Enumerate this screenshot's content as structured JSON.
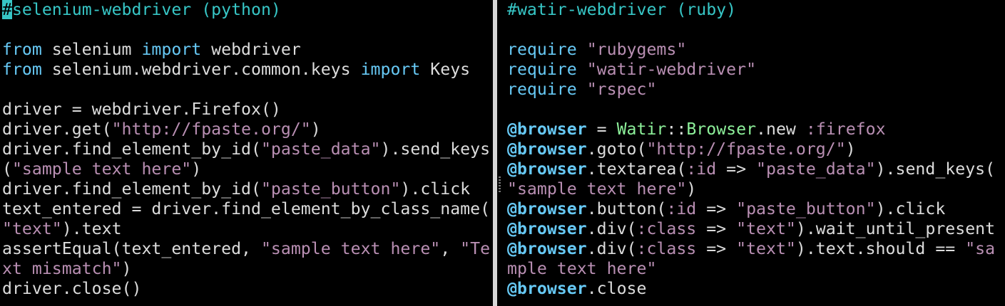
{
  "colors": {
    "background": "#000000",
    "default": "#dcdcdc",
    "keyword": "#67c9f5",
    "string": "#b98fb3",
    "comment": "#37c6c6",
    "ivar": "#67c9f5",
    "const": "#8df09a",
    "symbol": "#b98fb3",
    "cursor": "#37c6c6",
    "divider": "#d8d8d8"
  },
  "left_pane": {
    "lines": [
      [
        {
          "t": "#",
          "c": "cursor"
        },
        {
          "t": "selenium-webdriver (python)",
          "c": "comment"
        }
      ],
      [],
      [
        {
          "t": "from",
          "c": "keyword"
        },
        {
          "t": " selenium ",
          "c": "default"
        },
        {
          "t": "import",
          "c": "keyword"
        },
        {
          "t": " webdriver",
          "c": "default"
        }
      ],
      [
        {
          "t": "from",
          "c": "keyword"
        },
        {
          "t": " selenium.webdriver.common.keys ",
          "c": "default"
        },
        {
          "t": "import",
          "c": "keyword"
        },
        {
          "t": " Keys",
          "c": "default"
        }
      ],
      [],
      [
        {
          "t": "driver = webdriver.Firefox()",
          "c": "default"
        }
      ],
      [
        {
          "t": "driver.get(",
          "c": "default"
        },
        {
          "t": "\"http://fpaste.org/\"",
          "c": "string"
        },
        {
          "t": ")",
          "c": "default"
        }
      ],
      [
        {
          "t": "driver.find_element_by_id(",
          "c": "default"
        },
        {
          "t": "\"paste_data\"",
          "c": "string"
        },
        {
          "t": ").send_keys",
          "c": "default"
        }
      ],
      [
        {
          "t": "(",
          "c": "default"
        },
        {
          "t": "\"sample text here\"",
          "c": "string"
        },
        {
          "t": ")",
          "c": "default"
        }
      ],
      [
        {
          "t": "driver.find_element_by_id(",
          "c": "default"
        },
        {
          "t": "\"paste_button\"",
          "c": "string"
        },
        {
          "t": ").click",
          "c": "default"
        }
      ],
      [
        {
          "t": "text_entered = driver.find_element_by_class_name(",
          "c": "default"
        }
      ],
      [
        {
          "t": "\"text\"",
          "c": "string"
        },
        {
          "t": ").text",
          "c": "default"
        }
      ],
      [
        {
          "t": "assertEqual(text_entered, ",
          "c": "default"
        },
        {
          "t": "\"sample text here\"",
          "c": "string"
        },
        {
          "t": ", ",
          "c": "default"
        },
        {
          "t": "\"Te",
          "c": "string"
        }
      ],
      [
        {
          "t": "xt mismatch\"",
          "c": "string"
        },
        {
          "t": ")",
          "c": "default"
        }
      ],
      [
        {
          "t": "driver.close()",
          "c": "default"
        }
      ]
    ]
  },
  "right_pane": {
    "lines": [
      [
        {
          "t": "#watir-webdriver (ruby)",
          "c": "comment"
        }
      ],
      [],
      [
        {
          "t": "require",
          "c": "keyword"
        },
        {
          "t": " ",
          "c": "default"
        },
        {
          "t": "\"rubygems\"",
          "c": "string"
        }
      ],
      [
        {
          "t": "require",
          "c": "keyword"
        },
        {
          "t": " ",
          "c": "default"
        },
        {
          "t": "\"watir-webdriver\"",
          "c": "string"
        }
      ],
      [
        {
          "t": "require",
          "c": "keyword"
        },
        {
          "t": " ",
          "c": "default"
        },
        {
          "t": "\"rspec\"",
          "c": "string"
        }
      ],
      [],
      [
        {
          "t": "@browser",
          "c": "ivar"
        },
        {
          "t": " = ",
          "c": "default"
        },
        {
          "t": "Watir",
          "c": "const"
        },
        {
          "t": "::",
          "c": "default"
        },
        {
          "t": "Browser",
          "c": "const"
        },
        {
          "t": ".new ",
          "c": "default"
        },
        {
          "t": ":firefox",
          "c": "symbol"
        }
      ],
      [
        {
          "t": "@browser",
          "c": "ivar"
        },
        {
          "t": ".goto(",
          "c": "default"
        },
        {
          "t": "\"http://fpaste.org/\"",
          "c": "string"
        },
        {
          "t": ")",
          "c": "default"
        }
      ],
      [
        {
          "t": "@browser",
          "c": "ivar"
        },
        {
          "t": ".textarea(",
          "c": "default"
        },
        {
          "t": ":id",
          "c": "symbol"
        },
        {
          "t": " => ",
          "c": "default"
        },
        {
          "t": "\"paste_data\"",
          "c": "string"
        },
        {
          "t": ").send_keys(",
          "c": "default"
        }
      ],
      [
        {
          "t": "\"sample text here\"",
          "c": "string"
        },
        {
          "t": ")",
          "c": "default"
        }
      ],
      [
        {
          "t": "@browser",
          "c": "ivar"
        },
        {
          "t": ".button(",
          "c": "default"
        },
        {
          "t": ":id",
          "c": "symbol"
        },
        {
          "t": " => ",
          "c": "default"
        },
        {
          "t": "\"paste_button\"",
          "c": "string"
        },
        {
          "t": ").click",
          "c": "default"
        }
      ],
      [
        {
          "t": "@browser",
          "c": "ivar"
        },
        {
          "t": ".div(",
          "c": "default"
        },
        {
          "t": ":class",
          "c": "symbol"
        },
        {
          "t": " => ",
          "c": "default"
        },
        {
          "t": "\"text\"",
          "c": "string"
        },
        {
          "t": ").wait_until_present",
          "c": "default"
        }
      ],
      [
        {
          "t": "@browser",
          "c": "ivar"
        },
        {
          "t": ".div(",
          "c": "default"
        },
        {
          "t": ":class",
          "c": "symbol"
        },
        {
          "t": " => ",
          "c": "default"
        },
        {
          "t": "\"text\"",
          "c": "string"
        },
        {
          "t": ").text.should == ",
          "c": "default"
        },
        {
          "t": "\"sa",
          "c": "string"
        }
      ],
      [
        {
          "t": "mple text here\"",
          "c": "string"
        }
      ],
      [
        {
          "t": "@browser",
          "c": "ivar"
        },
        {
          "t": ".close",
          "c": "default"
        }
      ]
    ]
  }
}
